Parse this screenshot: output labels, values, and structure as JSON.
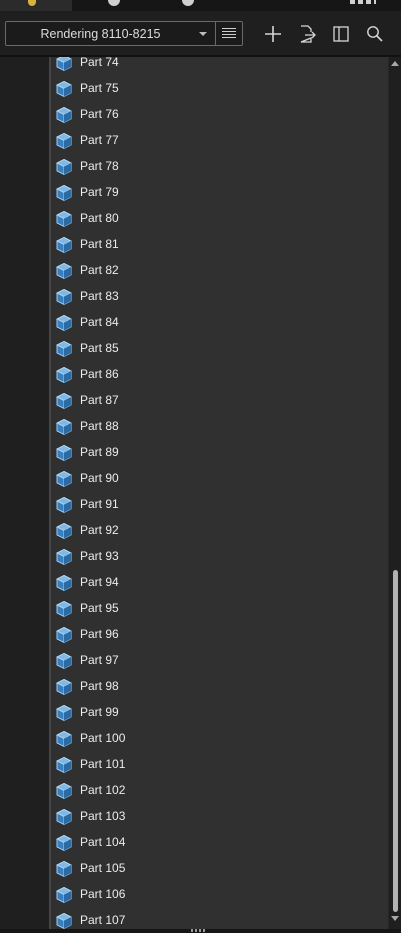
{
  "toolbar": {
    "rendering_selector": {
      "value": "Rendering 8110-8215"
    },
    "icons": {
      "list": "list-icon",
      "add": "plus-icon",
      "export": "export-icon",
      "panel": "panel-toggle-icon",
      "search": "search-icon"
    }
  },
  "parts": {
    "icon": "cube-icon",
    "items": [
      "Part 74",
      "Part 75",
      "Part 76",
      "Part 77",
      "Part 78",
      "Part 79",
      "Part 80",
      "Part 81",
      "Part 82",
      "Part 83",
      "Part 84",
      "Part 85",
      "Part 86",
      "Part 87",
      "Part 88",
      "Part 89",
      "Part 90",
      "Part 91",
      "Part 92",
      "Part 93",
      "Part 94",
      "Part 95",
      "Part 96",
      "Part 97",
      "Part 98",
      "Part 99",
      "Part 100",
      "Part 101",
      "Part 102",
      "Part 103",
      "Part 104",
      "Part 105",
      "Part 106",
      "Part 107"
    ]
  },
  "colors": {
    "background": "#1f1f1f",
    "list_background": "#303030",
    "cube_fill": "#3f88c4",
    "cube_top": "#7fb8e6",
    "text": "#ececec"
  }
}
